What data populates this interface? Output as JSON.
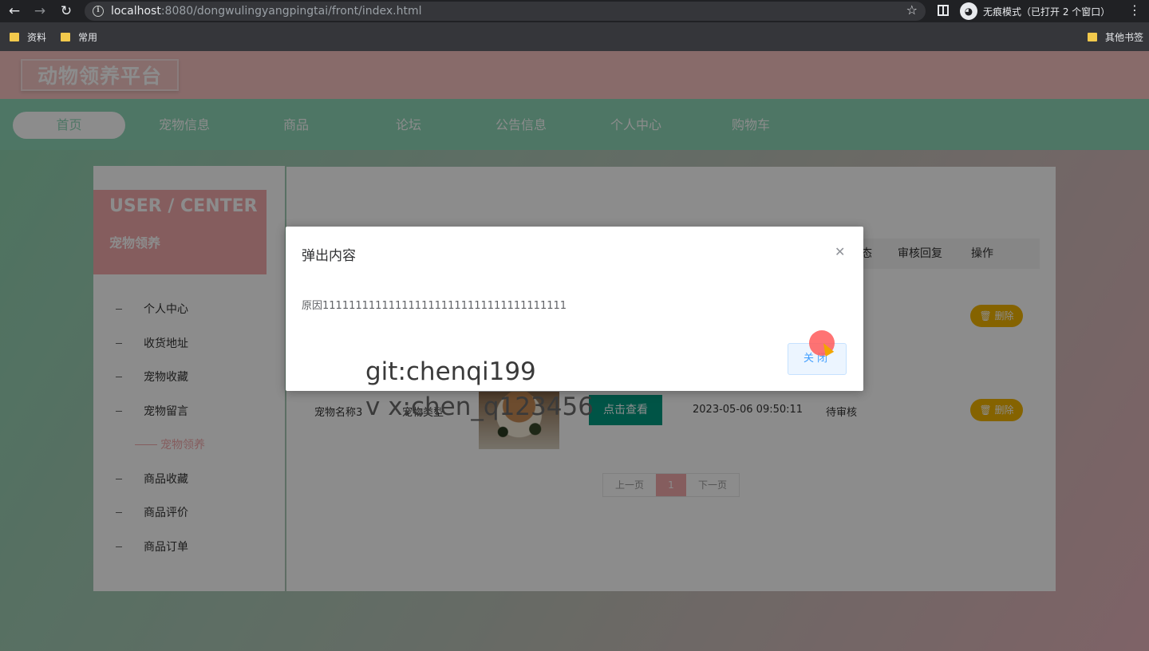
{
  "browser": {
    "url_host": "localhost",
    "url_rest": ":8080/dongwulingyangpingtai/front/index.html",
    "incognito_label": "无痕模式（已打开 2 个窗口）",
    "bookmarks": [
      "资料",
      "常用"
    ],
    "other_bookmarks": "其他书签"
  },
  "site": {
    "logo": "动物领养平台",
    "nav": [
      "首页",
      "宠物信息",
      "商品",
      "论坛",
      "公告信息",
      "个人中心",
      "购物车"
    ]
  },
  "sidebar": {
    "title": "USER / CENTER",
    "subtitle": "宠物领养",
    "items": [
      "个人中心",
      "收货地址",
      "宠物收藏",
      "宠物留言",
      "宠物领养",
      "商品收藏",
      "商品评价",
      "商品订单"
    ]
  },
  "table": {
    "headers": [
      "态",
      "审核回复",
      "操作"
    ],
    "row1": {
      "delete": "删除"
    },
    "row2": {
      "name": "宠物名称3",
      "type": "宠物类型",
      "view": "点击查看",
      "time": "2023-05-06 09:50:11",
      "status": "待审核",
      "delete": "删除"
    }
  },
  "pager": {
    "prev": "上一页",
    "current": "1",
    "next": "下一页"
  },
  "dialog": {
    "title": "弹出内容",
    "body": "原因1111111111111111111111111111111111111",
    "close_button": "关闭"
  },
  "watermark": {
    "line1": "git:chenqi199",
    "line2": "v x:chen_q123456"
  },
  "colors": {
    "header": "#f7c3c2",
    "nav": "#8fd7b8",
    "accent": "#f3a9ac",
    "view_button": "#009a80",
    "delete_button": "#f2b400"
  }
}
